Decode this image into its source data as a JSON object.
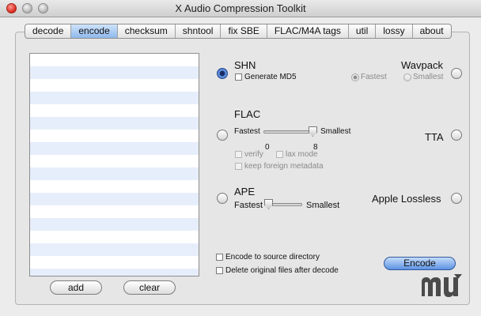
{
  "window": {
    "title": "X Audio Compression Toolkit"
  },
  "tabs": [
    "decode",
    "encode",
    "checksum",
    "shntool",
    "fix SBE",
    "FLAC/M4A tags",
    "util",
    "lossy",
    "about"
  ],
  "active_tab": "encode",
  "buttons": {
    "add": "add",
    "clear": "clear",
    "encode": "Encode"
  },
  "formats": {
    "shn": {
      "label": "SHN",
      "generate_md5": "Generate MD5",
      "selected": true
    },
    "wavpack": {
      "label": "Wavpack",
      "fastest": "Fastest",
      "smallest": "Smallest",
      "mode": "Fastest"
    },
    "flac": {
      "label": "FLAC",
      "fastest": "Fastest",
      "smallest": "Smallest",
      "min": "0",
      "max": "8",
      "level": 1.0,
      "verify": "verify",
      "lax_mode": "lax mode",
      "keep_metadata": "keep foreign metadata"
    },
    "tta": {
      "label": "TTA"
    },
    "ape": {
      "label": "APE",
      "fastest": "Fastest",
      "smallest": "Smallest",
      "level": 0.0
    },
    "alac": {
      "label": "Apple Lossless"
    }
  },
  "options": {
    "encode_to_source": "Encode to source directory",
    "delete_originals": "Delete original files after decode"
  },
  "colors": {
    "selected_tab": "#8fb8ec",
    "encode_button": "#5d93e3",
    "list_stripe": "#e7eefb"
  }
}
